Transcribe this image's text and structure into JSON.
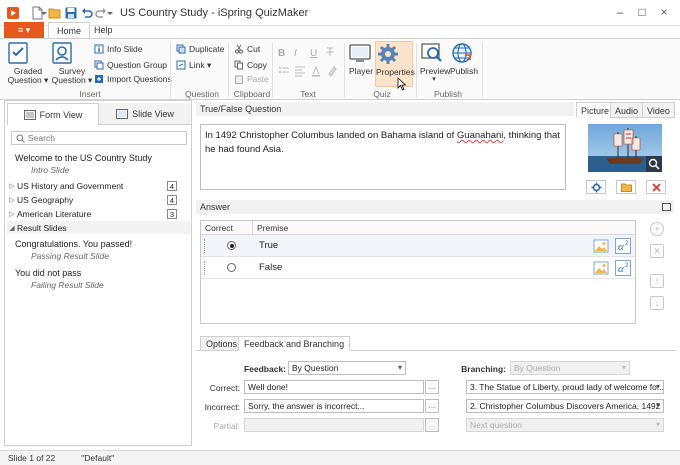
{
  "window": {
    "title": "US Country Study - iSpring QuizMaker",
    "controls": [
      "–",
      "□",
      "×"
    ]
  },
  "ribbon": {
    "file_label": "≡ ▾",
    "tabs": [
      {
        "label": "Home",
        "active": true
      },
      {
        "label": "Help",
        "active": false
      }
    ],
    "groups": {
      "insert": {
        "label": "Insert",
        "graded_question": "Graded Question ▾",
        "survey_question": "Survey Question ▾",
        "info_slide": "Info Slide",
        "question_group": "Question Group",
        "import_questions": "Import Questions"
      },
      "question": {
        "label": "Question",
        "duplicate": "Duplicate",
        "link": "Link ▾"
      },
      "clipboard": {
        "label": "Clipboard",
        "cut": "Cut",
        "copy": "Copy",
        "paste": "Paste"
      },
      "text": {
        "label": "Text",
        "bold": "B",
        "italic": "I",
        "underline": "U"
      },
      "quiz": {
        "label": "Quiz",
        "player": "Player",
        "properties": "Properties"
      },
      "publish": {
        "label": "Publish",
        "preview": "Preview",
        "publish": "Publish"
      }
    }
  },
  "left_pane": {
    "tabs": {
      "form_view": "Form View",
      "slide_view": "Slide View"
    },
    "search_placeholder": "Search",
    "intro": {
      "title": "Welcome to the US Country Study",
      "subtitle": "Intro Slide"
    },
    "groups": [
      {
        "label": "US History and Government",
        "count": "4"
      },
      {
        "label": "US Geography",
        "count": "4"
      },
      {
        "label": "American Literature",
        "count": "3"
      },
      {
        "label": "Result Slides",
        "count": ""
      }
    ],
    "results": [
      {
        "title": "Congratulations. You passed!",
        "subtitle": "Passing Result Slide"
      },
      {
        "title": "You did not pass",
        "subtitle": "Failing Result Slide"
      }
    ]
  },
  "question": {
    "header": "True/False Question",
    "text_before": "In 1492 Christopher Columbus landed on Bahama island of ",
    "text_misspelled": "Guanahani",
    "text_after": ", thinking that he had found Asia."
  },
  "media_tabs": [
    {
      "label": "Picture",
      "active": true
    },
    {
      "label": "Audio",
      "active": false
    },
    {
      "label": "Video",
      "active": false
    }
  ],
  "answer": {
    "header": "Answer",
    "columns": [
      "Correct",
      "Premise"
    ],
    "rows": [
      {
        "label": "True",
        "correct": true
      },
      {
        "label": "False",
        "correct": false
      }
    ]
  },
  "bottom_tabs": [
    {
      "label": "Options",
      "active": false
    },
    {
      "label": "Feedback and Branching",
      "active": true
    }
  ],
  "feedback": {
    "feedback_label": "Feedback:",
    "feedback_value": "By Question",
    "branching_label": "Branching:",
    "branching_value": "By Question",
    "correct_label": "Correct:",
    "correct_value": "Well done!",
    "correct_branch": "3. The Statue of Liberty, proud lady of welcome fo...",
    "incorrect_label": "Incorrect:",
    "incorrect_value": "Sorry, the answer is incorrect...",
    "incorrect_branch": "2. Christopher Columbus Discovers America, 1492",
    "partial_label": "Partial:",
    "partial_value": "",
    "partial_branch": "Next question",
    "dots_label": "..."
  },
  "status_bar": {
    "slide_info": "Slide 1 of 22",
    "theme": "\"Default\""
  },
  "colors": {
    "accent": "#e8571e",
    "blue_icon": "#2b6cb0",
    "highlight": "#fbe3cc"
  }
}
